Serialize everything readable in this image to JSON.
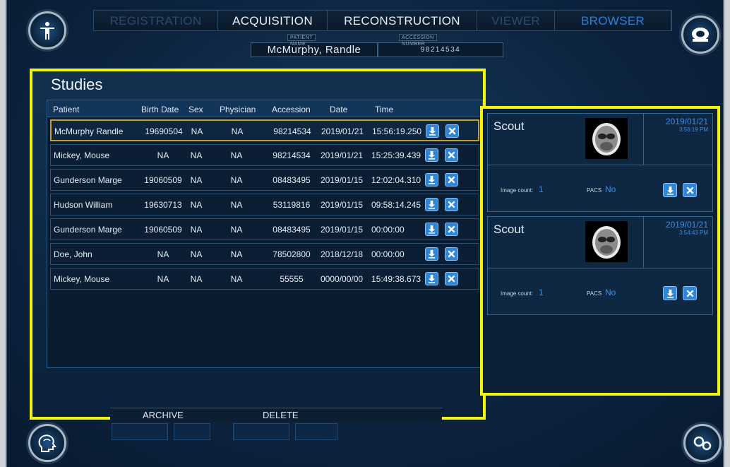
{
  "tabs": [
    {
      "label": "REGISTRATION",
      "state": "dim"
    },
    {
      "label": "ACQUISITION",
      "state": "lit"
    },
    {
      "label": "RECONSTRUCTION",
      "state": "lit"
    },
    {
      "label": "VIEWER",
      "state": "dim"
    },
    {
      "label": "BROWSER",
      "state": "active"
    }
  ],
  "patient": {
    "name_caption": "PATIENT NAME",
    "name": "McMurphy, Randle",
    "accession_caption": "ACCESSION NUMBER",
    "accession": "98214534"
  },
  "studies": {
    "title": "Studies",
    "columns": [
      "Patient",
      "Birth Date",
      "Sex",
      "Physician",
      "Accession",
      "Date",
      "Time"
    ],
    "rows": [
      {
        "patient": "McMurphy Randle",
        "birth_date": "19690504",
        "sex": "NA",
        "physician": "NA",
        "accession": "98214534",
        "date": "2019/01/21",
        "time": "15:56:19.250",
        "selected": true
      },
      {
        "patient": "Mickey, Mouse",
        "birth_date": "NA",
        "sex": "NA",
        "physician": "NA",
        "accession": "98214534",
        "date": "2019/01/21",
        "time": "15:25:39.439"
      },
      {
        "patient": "Gunderson Marge",
        "birth_date": "19060509",
        "sex": "NA",
        "physician": "NA",
        "accession": "08483495",
        "date": "2019/01/15",
        "time": "12:02:04.310"
      },
      {
        "patient": "Hudson William",
        "birth_date": "19630713",
        "sex": "NA",
        "physician": "NA",
        "accession": "53119816",
        "date": "2019/01/15",
        "time": "09:58:14.245"
      },
      {
        "patient": "Gunderson Marge",
        "birth_date": "19060509",
        "sex": "NA",
        "physician": "NA",
        "accession": "08483495",
        "date": "2019/01/15",
        "time": "00:00:00"
      },
      {
        "patient": "Doe, John",
        "birth_date": "NA",
        "sex": "NA",
        "physician": "NA",
        "accession": "78502800",
        "date": "2018/12/18",
        "time": "00:00:00"
      },
      {
        "patient": "Mickey, Mouse",
        "birth_date": "NA",
        "sex": "NA",
        "physician": "NA",
        "accession": "55555",
        "date": "0000/00/00",
        "time": "15:49:38.673"
      }
    ],
    "archive_label": "ARCHIVE",
    "delete_label": "DELETE"
  },
  "series": [
    {
      "title": "Scout",
      "date": "2019/01/21",
      "time": "3:56:19 PM",
      "image_count_label": "Image count:",
      "image_count": "1",
      "pacs_label": "PACS",
      "pacs": "No"
    },
    {
      "title": "Scout",
      "date": "2019/01/21",
      "time": "3:54:43 PM",
      "image_count_label": "Image count:",
      "image_count": "1",
      "pacs_label": "PACS",
      "pacs": "No"
    }
  ],
  "icons": [
    "person-icon",
    "scanner-icon",
    "brain-icon",
    "gears-icon",
    "download-icon",
    "delete-icon"
  ],
  "colors": {
    "highlight": "#f3f30f",
    "accent": "#2e7fd6",
    "selected_row": "#c79a2e"
  }
}
